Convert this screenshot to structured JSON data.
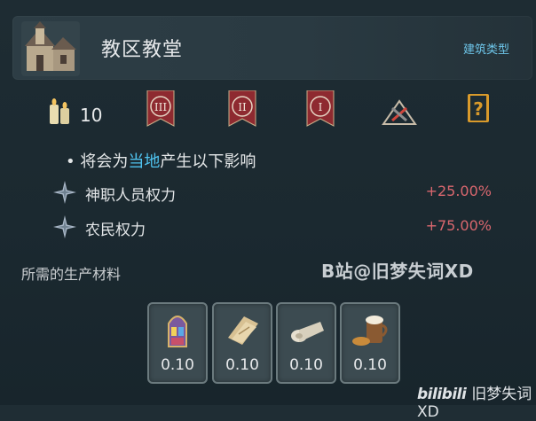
{
  "header": {
    "title": "教区教堂",
    "building_type_label": "建筑类型"
  },
  "icon_row": {
    "candle_count": "10",
    "banners": [
      "III",
      "II",
      "I"
    ],
    "accent_color": "#8e2a30"
  },
  "effects": {
    "intro_prefix": "• 将会为",
    "intro_highlight": "当地",
    "intro_suffix": "产生以下影响",
    "items": [
      {
        "label": "神职人员权力",
        "value": "+25.00%"
      },
      {
        "label": "农民权力",
        "value": "+75.00%"
      }
    ]
  },
  "materials": {
    "label": "所需的生产材料",
    "items": [
      {
        "icon": "stained-glass-icon",
        "amount": "0.10"
      },
      {
        "icon": "paper-icon",
        "amount": "0.10"
      },
      {
        "icon": "cloth-icon",
        "amount": "0.10"
      },
      {
        "icon": "food-drink-icon",
        "amount": "0.10"
      }
    ]
  },
  "watermark": "B站@旧梦失词XD",
  "bilibili": {
    "logo": "bilibili",
    "name": "旧梦失词XD"
  }
}
